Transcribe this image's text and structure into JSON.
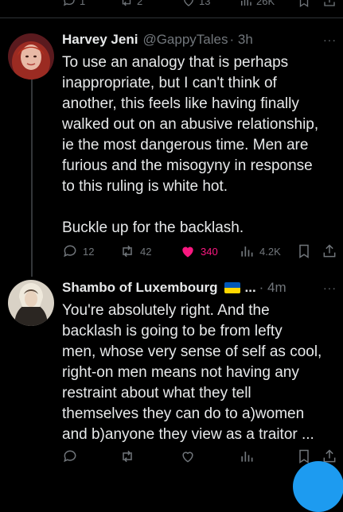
{
  "top_actions": {
    "replies": "1",
    "reposts": "2",
    "likes": "13",
    "views": "26K"
  },
  "tweets": [
    {
      "name": "Harvey Jeni",
      "handle": "@GappyTales",
      "time": "· 3h",
      "body_lines": [
        "To use an analogy that is perhaps",
        "inappropriate, but I can't think of",
        "another, this feels like having finally",
        "walked out on an abusive relationship,",
        "ie the most dangerous time. Men are",
        "furious and the misogyny in response",
        "to this ruling is white hot."
      ],
      "body_last": "Buckle up for the backlash.",
      "replies": "12",
      "reposts": "42",
      "likes": "340",
      "views": "4.2K"
    },
    {
      "name": "Shambo of Luxembourg",
      "handle": "...",
      "time": "· 4m",
      "body_lines": [
        "You're absolutely right. And the",
        "backlash is going to be from lefty",
        "men, whose very sense of self as cool,",
        "right-on men means not having any",
        "restraint about what they tell",
        "themselves they can do to a)women",
        "and b)anyone they view as a traitor ..."
      ]
    }
  ],
  "colors": {
    "background": "#000000",
    "text": "#e7e9ea",
    "muted": "#71767b",
    "like": "#f91880",
    "accent": "#1d9bf0"
  },
  "icons": [
    "reply-icon",
    "repost-icon",
    "like-icon",
    "views-icon",
    "bookmark-icon",
    "share-icon",
    "more-icon",
    "ukraine-flag-icon"
  ]
}
